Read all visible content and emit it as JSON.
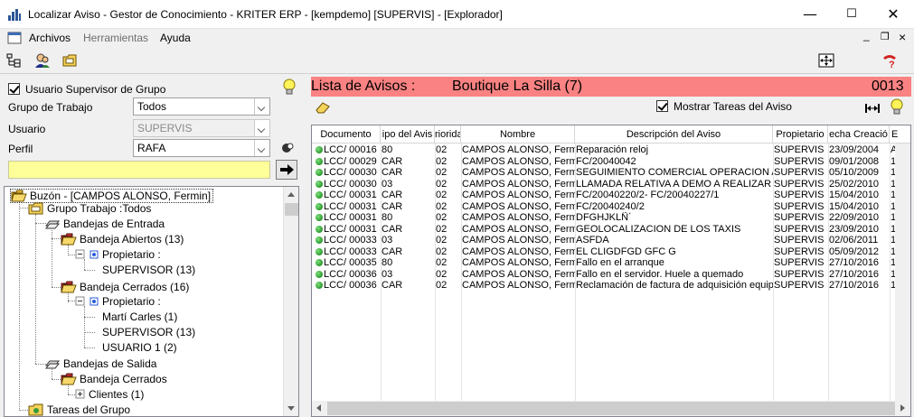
{
  "window": {
    "title": "Localizar Aviso - Gestor de Conocimiento - KRITER ERP - [kempdemo] [SUPERVIS] - [Explorador]",
    "controls": {
      "minimize": "—",
      "maximize": "☐",
      "close": "✕"
    }
  },
  "menu": {
    "items": [
      "Archivos",
      "Herramientas",
      "Ayuda"
    ],
    "mdi_controls": {
      "minimize": "_",
      "restore": "❐",
      "close": "×"
    }
  },
  "filters": {
    "supervisor_checkbox_label": "Usuario Supervisor de Grupo",
    "supervisor_checked": true,
    "grupo_label": "Grupo de Trabajo",
    "grupo_value": "Todos",
    "usuario_label": "Usuario",
    "usuario_value": "SUPERVIS",
    "perfil_label": "Perfil",
    "perfil_value": "RAFA",
    "search_value": ""
  },
  "tree": {
    "nodes": [
      {
        "label": "Buzón - [CAMPOS ALONSO, Fermin]"
      },
      {
        "label": "Grupo Trabajo :Todos"
      },
      {
        "label": "Bandejas de Entrada"
      },
      {
        "label": "Bandeja Abiertos (13)"
      },
      {
        "label": "Propietario :"
      },
      {
        "label": "SUPERVISOR (13)"
      },
      {
        "label": "Bandeja Cerrados (16)"
      },
      {
        "label": "Propietario :"
      },
      {
        "label": "Martí Carles (1)"
      },
      {
        "label": "SUPERVISOR (13)"
      },
      {
        "label": "USUARIO 1 (2)"
      },
      {
        "label": "Bandejas de Salida"
      },
      {
        "label": "Bandeja Cerrados"
      },
      {
        "label": "Clientes (1)"
      },
      {
        "label": "Tareas del Grupo"
      }
    ]
  },
  "list": {
    "title": "Lista de Avisos :",
    "client": "Boutique La Silla (7)",
    "count": "0013",
    "show_tasks_label": "Mostrar Tareas del Aviso",
    "show_tasks_checked": true,
    "columns": [
      "Documento",
      "ipo del Avis",
      "riorida",
      "Nombre",
      "Descripción del Aviso",
      "Propietario",
      "echa Creació",
      "E"
    ],
    "rows": [
      [
        "LCC/ 00016",
        "80",
        "02",
        "CAMPOS ALONSO, Ferm",
        "Reparación reloj",
        "SUPERVIS",
        "23/09/2004",
        "A"
      ],
      [
        "LCC/ 00029",
        "CAR",
        "02",
        "CAMPOS ALONSO, Ferm",
        "FC/20040042",
        "SUPERVIS",
        "09/01/2008",
        "1"
      ],
      [
        "LCC/ 00030",
        "CAR",
        "02",
        "CAMPOS ALONSO, Ferm",
        "SEGUIMIENTO COMERCIAL OPERACION A",
        "SUPERVIS",
        "05/10/2009",
        "1"
      ],
      [
        "LCC/ 00030",
        "03",
        "02",
        "CAMPOS ALONSO, Ferm",
        "LLAMADA RELATIVA A DEMO A REALIZAR",
        "SUPERVIS",
        "25/02/2010",
        "1"
      ],
      [
        "LCC/ 00031",
        "CAR",
        "02",
        "CAMPOS ALONSO, Ferm",
        "FC/20040220/2- FC/20040227/1",
        "SUPERVIS",
        "15/04/2010",
        "1"
      ],
      [
        "LCC/ 00031",
        "CAR",
        "02",
        "CAMPOS ALONSO, Ferm",
        "FC/20040240/2",
        "SUPERVIS",
        "15/04/2010",
        "1"
      ],
      [
        "LCC/ 00031",
        "80",
        "02",
        "CAMPOS ALONSO, Ferm",
        "DFGHJKLÑ´",
        "SUPERVIS",
        "22/09/2010",
        "1"
      ],
      [
        "LCC/ 00031",
        "CAR",
        "02",
        "CAMPOS ALONSO, Ferm",
        "GEOLOCALIZACION DE LOS TAXIS",
        "SUPERVIS",
        "23/09/2010",
        "1"
      ],
      [
        "LCC/ 00033",
        "03",
        "02",
        "CAMPOS ALONSO, Ferm",
        "ASFDA",
        "SUPERVIS",
        "02/06/2011",
        "1"
      ],
      [
        "LCC/ 00033",
        "CAR",
        "02",
        "CAMPOS ALONSO, Ferm",
        "EL CLIGDFGD GFC G",
        "SUPERVIS",
        "05/09/2012",
        "1"
      ],
      [
        "LCC/ 00035",
        "80",
        "02",
        "CAMPOS ALONSO, Ferm",
        "Fallo en el arranque",
        "SUPERVIS",
        "27/10/2016",
        "1"
      ],
      [
        "LCC/ 00036",
        "03",
        "02",
        "CAMPOS ALONSO, Ferm",
        "Fallo en el servidor. Huele a quemado",
        "SUPERVIS",
        "27/10/2016",
        "1"
      ],
      [
        "LCC/ 00036",
        "CAR",
        "02",
        "CAMPOS ALONSO, Ferm",
        "Reclamación de factura de adquisición equipo",
        "SUPERVIS",
        "27/10/2016",
        "1"
      ]
    ]
  },
  "colors": {
    "list_header_bg": "#fa8282",
    "search_bg": "#ffff99",
    "status_dot": "#1a9a1a"
  }
}
